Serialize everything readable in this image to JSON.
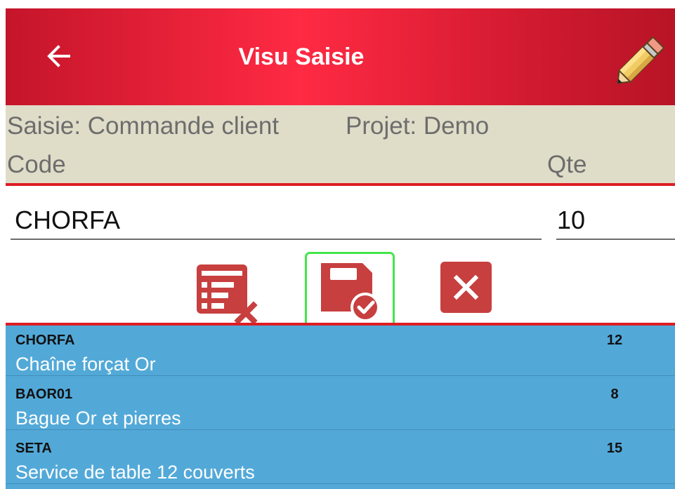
{
  "app": {
    "title": "Visu Saisie"
  },
  "context": {
    "saisie": "Saisie: Commande client",
    "projet": "Projet: Demo",
    "code_label": "Code",
    "quantity_label": "Qte"
  },
  "form": {
    "code_value": "CHORFA",
    "quantity_value": "10"
  },
  "icons": {
    "back": "arrow-left-icon",
    "edit": "pencil-icon",
    "remove_line": "remove-line-icon",
    "save": "save-confirm-icon",
    "cancel": "close-icon"
  },
  "colors": {
    "toolbar": "#e91e36",
    "info_band": "#dfdcc8",
    "accent_red": "#dd1d24",
    "selected_border": "#44e64a",
    "list_background": "#52a9d8"
  },
  "items": [
    {
      "code": "CHORFA",
      "quantity": "12",
      "description": "Chaîne forçat Or"
    },
    {
      "code": "BAOR01",
      "quantity": "8",
      "description": "Bague Or et pierres"
    },
    {
      "code": "SETA",
      "quantity": "15",
      "description": "Service de table 12 couverts"
    }
  ]
}
